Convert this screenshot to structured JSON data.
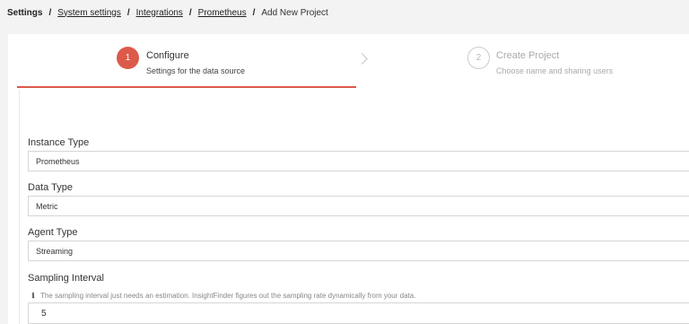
{
  "breadcrumb": {
    "root": "Settings",
    "links": [
      "System settings",
      "Integrations",
      "Prometheus"
    ],
    "current": "Add New Project",
    "separator": "/"
  },
  "steps": [
    {
      "number": "1",
      "title": "Configure",
      "subtitle": "Settings for the data source",
      "active": true
    },
    {
      "number": "2",
      "title": "Create Project",
      "subtitle": "Choose name and sharing users",
      "active": false
    }
  ],
  "form": {
    "instance_type": {
      "label": "Instance Type",
      "value": "Prometheus"
    },
    "data_type": {
      "label": "Data Type",
      "value": "Metric"
    },
    "agent_type": {
      "label": "Agent Type",
      "value": "Streaming"
    },
    "sampling_interval": {
      "label": "Sampling Interval",
      "hint": "The sampling interval just needs an estimation. InsightFinder figures out the sampling rate dynamically from your data.",
      "value": "5"
    }
  },
  "colors": {
    "accent": "#dc5a4a",
    "background": "#f3f3f3",
    "panel": "#ffffff"
  },
  "icons": {
    "info": "info-icon",
    "step_separator": "chevron-right-icon"
  }
}
